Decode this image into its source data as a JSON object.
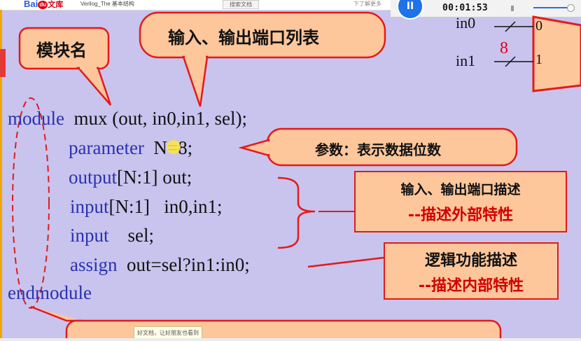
{
  "browser": {
    "logo_bai": "Bai",
    "logo_du": "du",
    "logo_wenku": "文库",
    "doc_title": "Verilog_The 基本结构",
    "search_button": "搜索文档",
    "right_fragment": "下了解更多"
  },
  "player": {
    "pause_glyph": "II",
    "time": "00:01:53"
  },
  "diagram": {
    "in0": "in0",
    "in1": "in1",
    "bus_width": "8",
    "sel0": "0",
    "sel1": "1"
  },
  "code": {
    "l1_kw": "module",
    "l1_rest": "mux (out, in0,in1, sel);",
    "l2_kw": "parameter",
    "l2_rest": "N=8;",
    "l3_kw": "output",
    "l3_rest": "[N:1] out;",
    "l4_kw": "input",
    "l4_rest": "[N:1]   in0,in1;",
    "l5_kw": "input",
    "l5_rest": "sel;",
    "l6_kw": "assign",
    "l6_rest": "out=sel?in1:in0;",
    "l7_kw": "endmodule"
  },
  "callouts": {
    "module_name": "模块名",
    "port_list": "输入、输出端口列表",
    "param": "参数：表示数据位数",
    "io_desc": "输入、输出端口描述",
    "io_desc_sub": "--描述外部特性",
    "logic_desc": "逻辑功能描述",
    "logic_desc_sub": "--描述内部特性"
  },
  "tooltip": "好文档，让好朋友也看到",
  "colors": {
    "background": "#c8c4ee",
    "callout_fill": "#fdc69b",
    "callout_border": "#e31a1a",
    "keyword": "#2a31b0"
  }
}
